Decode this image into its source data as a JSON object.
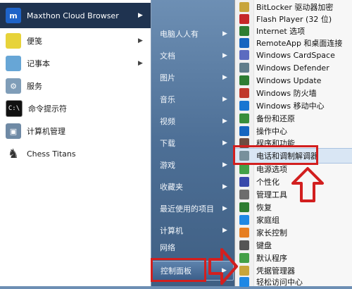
{
  "left_pane": {
    "items": [
      {
        "label": "Maxthon Cloud Browser",
        "icon": "maxthon-logo-icon",
        "color": "#1e63c8",
        "arrow": true
      },
      {
        "label": "便笺",
        "icon": "sticky-note-icon",
        "color": "#e7d33a",
        "arrow": true
      },
      {
        "label": "记事本",
        "icon": "notepad-icon",
        "color": "#67a6d6",
        "arrow": true
      },
      {
        "label": "服务",
        "icon": "services-gear-icon",
        "color": "#7f9db8",
        "arrow": false
      },
      {
        "label": "命令提示符",
        "icon": "command-prompt-icon",
        "color": "#111111",
        "arrow": false
      },
      {
        "label": "计算机管理",
        "icon": "computer-management-icon",
        "color": "#6f8aa5",
        "arrow": false
      },
      {
        "label": "Chess Titans",
        "icon": "chess-icon",
        "color": "#333333",
        "arrow": false
      }
    ]
  },
  "middle_pane": {
    "items": [
      {
        "label": "电脑人人有",
        "arrow": true
      },
      {
        "label": "文档",
        "arrow": true
      },
      {
        "label": "图片",
        "arrow": true
      },
      {
        "label": "音乐",
        "arrow": true
      },
      {
        "label": "视频",
        "arrow": true
      },
      {
        "label": "下载",
        "arrow": true
      },
      {
        "label": "游戏",
        "arrow": true
      },
      {
        "label": "收藏夹",
        "arrow": true
      },
      {
        "label": "最近使用的项目",
        "arrow": true
      },
      {
        "label": "计算机",
        "arrow": true
      },
      {
        "label": "网络",
        "arrow": false
      },
      {
        "label": "控制面板",
        "arrow": true
      }
    ]
  },
  "submenu": {
    "items": [
      {
        "label": "BitLocker 驱动器加密",
        "color": "#c8a53b"
      },
      {
        "label": "Flash Player (32 位)",
        "color": "#c62828"
      },
      {
        "label": "Internet 选项",
        "color": "#2e7d32"
      },
      {
        "label": "RemoteApp 和桌面连接",
        "color": "#1565c0"
      },
      {
        "label": "Windows CardSpace",
        "color": "#5c6bc0"
      },
      {
        "label": "Windows Defender",
        "color": "#607d8b"
      },
      {
        "label": "Windows Update",
        "color": "#2e7d32"
      },
      {
        "label": "Windows 防火墙",
        "color": "#c0392b"
      },
      {
        "label": "Windows 移动中心",
        "color": "#1976d2"
      },
      {
        "label": "备份和还原",
        "color": "#388e3c"
      },
      {
        "label": "操作中心",
        "color": "#1565c0"
      },
      {
        "label": "程序和功能",
        "color": "#6d4c41"
      },
      {
        "label": "电话和调制解调器",
        "color": "#78909c"
      },
      {
        "label": "电源选项",
        "color": "#43a047"
      },
      {
        "label": "个性化",
        "color": "#3949ab"
      },
      {
        "label": "管理工具",
        "color": "#6d6d6d"
      },
      {
        "label": "恢复",
        "color": "#2e7d32"
      },
      {
        "label": "家庭组",
        "color": "#1e88e5"
      },
      {
        "label": "家长控制",
        "color": "#e67e22"
      },
      {
        "label": "键盘",
        "color": "#555555"
      },
      {
        "label": "默认程序",
        "color": "#43a047"
      },
      {
        "label": "凭据管理器",
        "color": "#c8a53b"
      },
      {
        "label": "轻松访问中心",
        "color": "#1e88e5"
      }
    ]
  }
}
